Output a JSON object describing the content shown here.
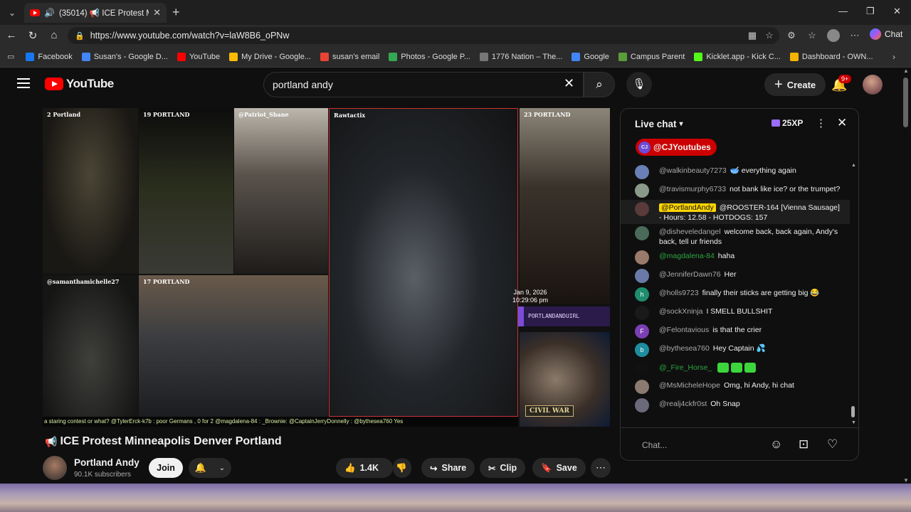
{
  "browser": {
    "tab_title": "(35014) 📢 ICE Protest Minneapolis Denver Portland",
    "url": "https://www.youtube.com/watch?v=laW8B6_oPNw",
    "chat_label": "Chat",
    "bookmarks": [
      {
        "label": "Facebook",
        "color": "#1877f2"
      },
      {
        "label": "Susan's - Google D...",
        "color": "#4285f4"
      },
      {
        "label": "YouTube",
        "color": "#ff0000"
      },
      {
        "label": "My Drive - Google...",
        "color": "#fbbc04"
      },
      {
        "label": "susan's email",
        "color": "#ea4335"
      },
      {
        "label": "Photos - Google P...",
        "color": "#34a853"
      },
      {
        "label": "1776 Nation – The...",
        "color": "#777777"
      },
      {
        "label": "Google",
        "color": "#4285f4"
      },
      {
        "label": "Campus Parent",
        "color": "#5a9e3a"
      },
      {
        "label": "Kicklet.app - Kick C...",
        "color": "#53fc18"
      },
      {
        "label": "Dashboard - OWN...",
        "color": "#f4b400"
      }
    ]
  },
  "youtube": {
    "logo_text": "YouTube",
    "search_value": "portland andy",
    "create_label": "Create",
    "notif_count": "9+"
  },
  "video": {
    "cells": [
      "2 Portland",
      "19 PORTLAND",
      "@Patriot_Shane",
      "Rawtactix",
      "23 PORTLAND",
      "@samanthamichelle27",
      "17 PORTLAND"
    ],
    "timestamp_date": "Jan 9, 2026",
    "timestamp_time": "10:29:06 pm",
    "banner": "PORTLANDANDUIRL",
    "civil_war": "CIVIL WAR",
    "ticker": "a staring contest or what?   @TylerErck-k7b : poor Germans , 0 for 2   @magdalena-84 : _Brownie:   @CaptainJerryDonnelly : @bythesea760 Yes"
  },
  "meta": {
    "title": "ICE Protest Minneapolis Denver Portland",
    "channel": "Portland Andy",
    "subscribers": "90.1K subscribers",
    "join": "Join",
    "likes": "1.4K",
    "share": "Share",
    "clip": "Clip",
    "save": "Save"
  },
  "chat": {
    "header": "Live chat",
    "xp": "25XP",
    "pinned_user": "@CJYoutubes",
    "pinned_initials": "CJ",
    "input_placeholder": "Chat...",
    "messages": [
      {
        "author": "@walkinbeauty7273",
        "text": "🥣 everything again",
        "avatar_color": "#6a7fb5",
        "initial": "",
        "style": ""
      },
      {
        "author": "@travismurphy6733",
        "text": "not bank like ice? or the trumpet?",
        "avatar_color": "#8a9a8a",
        "initial": "",
        "style": ""
      },
      {
        "author": "@PortlandAndy",
        "text": "@ROOSTER-164 [Vienna Sausage] - Hours: 12.58 - HOTDOGS: 157",
        "avatar_color": "#5a3a3a",
        "initial": "",
        "style": "hl"
      },
      {
        "author": "@disheveledangel",
        "text": "welcome back, back again, Andy's back, tell ur friends",
        "avatar_color": "#4a6a5a",
        "initial": "",
        "style": ""
      },
      {
        "author": "@magdalena-84",
        "text": "haha",
        "avatar_color": "#9a7a6a",
        "initial": "",
        "style": "green"
      },
      {
        "author": "@JenniferDawn76",
        "text": "Her",
        "avatar_color": "#6a7aa8",
        "initial": "",
        "style": ""
      },
      {
        "author": "@holls9723",
        "text": "finally their sticks are getting big 😂",
        "avatar_color": "#1e8e6e",
        "initial": "h",
        "style": ""
      },
      {
        "author": "@sockXninja",
        "text": "I SMELL BULLSHIT",
        "avatar_color": "#1a1a1a",
        "initial": "",
        "style": ""
      },
      {
        "author": "@Felontavious",
        "text": "is that the crier",
        "avatar_color": "#7b3fb5",
        "initial": "F",
        "style": ""
      },
      {
        "author": "@bythesea760",
        "text": "Hey Captain 💦",
        "avatar_color": "#1e8e9e",
        "initial": "b",
        "style": ""
      },
      {
        "author": "@_Fire_Horse_",
        "text": "",
        "avatar_color": "#111111",
        "initial": "",
        "style": "green"
      },
      {
        "author": "@MsMicheleHope",
        "text": "Omg, hi Andy, hi chat",
        "avatar_color": "#8a7a70",
        "initial": "",
        "style": ""
      },
      {
        "author": "@realj4ckfr0st",
        "text": "Oh Snap",
        "avatar_color": "#6a6a7a",
        "initial": "",
        "style": ""
      }
    ]
  }
}
